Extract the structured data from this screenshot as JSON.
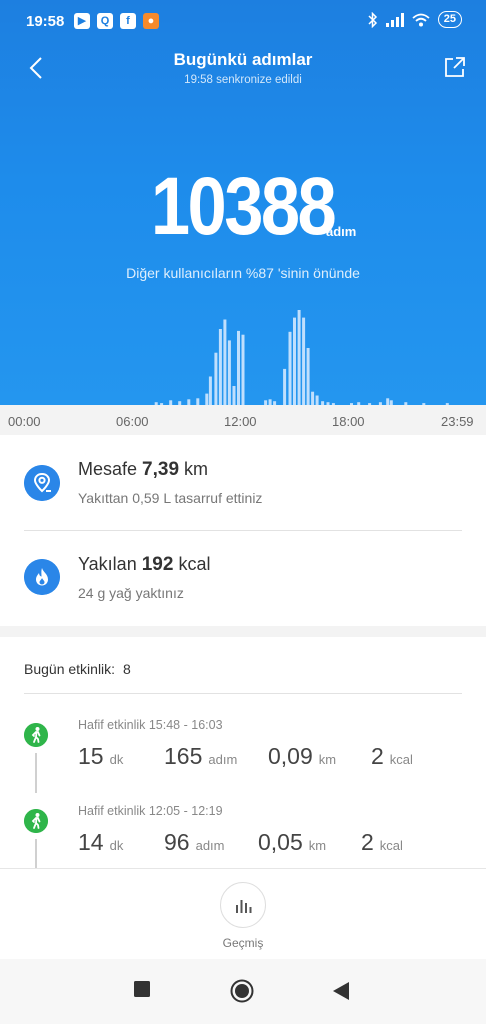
{
  "status_bar": {
    "time": "19:58",
    "battery": "25",
    "left_icons": [
      "youtube-icon",
      "q-app-icon",
      "facebook-icon",
      "orange-app-icon"
    ],
    "right_icons": [
      "bluetooth-icon",
      "signal-icon",
      "wifi-icon",
      "battery-icon"
    ]
  },
  "header": {
    "title": "Bugünkü adımlar",
    "subtitle": "19:58 senkronize edildi"
  },
  "summary": {
    "steps": "10388",
    "steps_unit": "adım",
    "rank_text": "Diğer kullanıcıların %87 'sinin önünde"
  },
  "chart_data": {
    "type": "bar",
    "title": "",
    "xlabel": "",
    "ylabel": "",
    "x_ticks": [
      "00:00",
      "06:00",
      "12:00",
      "18:00",
      "23:59"
    ],
    "x_range_hours": [
      0,
      24
    ],
    "ylim": [
      0,
      100
    ],
    "bars": [
      {
        "h": 7.2,
        "v": 3
      },
      {
        "h": 7.5,
        "v": 2
      },
      {
        "h": 8.0,
        "v": 5
      },
      {
        "h": 8.5,
        "v": 4
      },
      {
        "h": 9.0,
        "v": 6
      },
      {
        "h": 9.5,
        "v": 7
      },
      {
        "h": 10.0,
        "v": 12
      },
      {
        "h": 10.2,
        "v": 30
      },
      {
        "h": 10.5,
        "v": 55
      },
      {
        "h": 10.75,
        "v": 80
      },
      {
        "h": 11.0,
        "v": 90
      },
      {
        "h": 11.25,
        "v": 68
      },
      {
        "h": 11.5,
        "v": 20
      },
      {
        "h": 11.75,
        "v": 78
      },
      {
        "h": 12.0,
        "v": 74
      },
      {
        "h": 13.25,
        "v": 5
      },
      {
        "h": 13.5,
        "v": 6
      },
      {
        "h": 13.75,
        "v": 4
      },
      {
        "h": 14.3,
        "v": 38
      },
      {
        "h": 14.6,
        "v": 77
      },
      {
        "h": 14.85,
        "v": 92
      },
      {
        "h": 15.1,
        "v": 100
      },
      {
        "h": 15.35,
        "v": 92
      },
      {
        "h": 15.6,
        "v": 60
      },
      {
        "h": 15.85,
        "v": 14
      },
      {
        "h": 16.1,
        "v": 10
      },
      {
        "h": 16.4,
        "v": 4
      },
      {
        "h": 16.7,
        "v": 3
      },
      {
        "h": 17.0,
        "v": 2
      },
      {
        "h": 18.0,
        "v": 2
      },
      {
        "h": 18.4,
        "v": 3
      },
      {
        "h": 19.0,
        "v": 2
      },
      {
        "h": 19.6,
        "v": 3
      },
      {
        "h": 20.0,
        "v": 7
      },
      {
        "h": 20.2,
        "v": 5
      },
      {
        "h": 21.0,
        "v": 3
      },
      {
        "h": 22.0,
        "v": 2
      },
      {
        "h": 23.3,
        "v": 2
      }
    ]
  },
  "distance": {
    "label": "Mesafe",
    "value": "7,39",
    "unit": "km",
    "sub": "Yakıttan 0,59 L tasarruf ettiniz"
  },
  "calories": {
    "label": "Yakılan",
    "value": "192",
    "unit": "kcal",
    "sub": "24 g yağ yaktınız"
  },
  "activities": {
    "count_label": "Bugün etkinlik:",
    "count": "8",
    "items": [
      {
        "title": "Hafif etkinlik 15:48 - 16:03",
        "minutes": "15",
        "minutes_unit": "dk",
        "steps": "165",
        "steps_unit": "adım",
        "distance": "0,09",
        "distance_unit": "km",
        "kcal": "2",
        "kcal_unit": "kcal"
      },
      {
        "title": "Hafif etkinlik 12:05 - 12:19",
        "minutes": "14",
        "minutes_unit": "dk",
        "steps": "96",
        "steps_unit": "adım",
        "distance": "0,05",
        "distance_unit": "km",
        "kcal": "2",
        "kcal_unit": "kcal"
      }
    ]
  },
  "bottom": {
    "history_label": "Geçmiş"
  },
  "colors": {
    "header_blue": "#1e8ceb",
    "icon_blue": "#2a86e8",
    "activity_green": "#2fb54a"
  }
}
